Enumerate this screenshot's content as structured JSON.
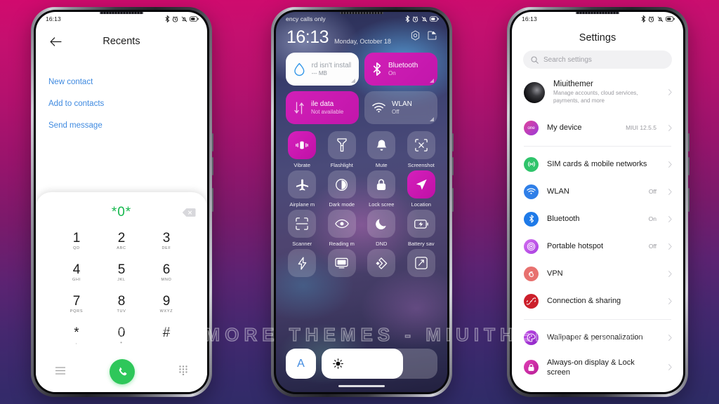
{
  "background": {
    "top_color": "#d10a6e",
    "bottom_color": "#2e2c66"
  },
  "watermark": {
    "text": "VISIT FOR MORE THEMES - MIUITHEMER.COM"
  },
  "phone1": {
    "status": {
      "time": "16:13",
      "icons": [
        "bluetooth-icon",
        "alarm-icon",
        "vibrate-icon",
        "battery-icon"
      ]
    },
    "header": {
      "back": "back-arrow-icon",
      "title": "Recents"
    },
    "links": [
      {
        "label": "New contact"
      },
      {
        "label": "Add to contacts"
      },
      {
        "label": "Send message"
      }
    ],
    "dialer": {
      "number": "*0*",
      "backspace": "backspace-icon",
      "keys": [
        {
          "digit": "1",
          "letters": "QD"
        },
        {
          "digit": "2",
          "letters": "ABC"
        },
        {
          "digit": "3",
          "letters": "DEF"
        },
        {
          "digit": "4",
          "letters": "GHI"
        },
        {
          "digit": "5",
          "letters": "JKL"
        },
        {
          "digit": "6",
          "letters": "MNO"
        },
        {
          "digit": "7",
          "letters": "PQRS"
        },
        {
          "digit": "8",
          "letters": "TUV"
        },
        {
          "digit": "9",
          "letters": "WXYZ"
        },
        {
          "digit": "*",
          "letters": ","
        },
        {
          "digit": "0",
          "letters": "+"
        },
        {
          "digit": "#",
          "letters": ""
        }
      ],
      "bottom": {
        "left_icon": "menu-icon",
        "call_icon": "phone-call-icon",
        "right_icon": "keypad-icon"
      },
      "call_button_color": "#2ec75a",
      "number_color": "#16b84e"
    }
  },
  "phone2": {
    "status": {
      "carrier": "ency calls only",
      "icons": [
        "bluetooth-icon",
        "alarm-icon",
        "vibrate-icon",
        "battery-icon"
      ]
    },
    "clock": {
      "time": "16:13",
      "date": "Monday, October 18"
    },
    "clock_actions": [
      {
        "name": "settings-gear-icon"
      },
      {
        "name": "edit-icon"
      }
    ],
    "big_tiles": [
      {
        "name": "sim-data-tile",
        "icon": "water-drop-icon",
        "title": "rd isn't install",
        "subtitle": "--- MB",
        "state": "white"
      },
      {
        "name": "bluetooth-tile",
        "icon": "bluetooth-icon",
        "title": "Bluetooth",
        "subtitle": "On",
        "state": "magenta"
      },
      {
        "name": "mobile-data-tile",
        "icon": "data-arrows-icon",
        "title": "ile data",
        "subtitle": "Not available",
        "state": "magenta"
      },
      {
        "name": "wlan-tile",
        "icon": "wifi-icon",
        "title": "WLAN",
        "subtitle": "Off",
        "state": "glass"
      }
    ],
    "toggles": [
      {
        "label": "Vibrate",
        "icon": "vibrate-icon",
        "on": true
      },
      {
        "label": "Flashlight",
        "icon": "flashlight-icon",
        "on": false
      },
      {
        "label": "Mute",
        "icon": "bell-icon",
        "on": false
      },
      {
        "label": "Screenshot",
        "icon": "screenshot-icon",
        "on": false
      },
      {
        "label": "Airplane m",
        "icon": "airplane-icon",
        "on": false
      },
      {
        "label": "Dark mode",
        "icon": "contrast-icon",
        "on": false
      },
      {
        "label": "Lock scree",
        "icon": "lock-icon",
        "on": false
      },
      {
        "label": "Location",
        "icon": "location-arrow-icon",
        "on": true
      },
      {
        "label": "Scanner",
        "icon": "scan-frame-icon",
        "on": false
      },
      {
        "label": "Reading m",
        "icon": "eye-icon",
        "on": false
      },
      {
        "label": "DND",
        "icon": "moon-icon",
        "on": false
      },
      {
        "label": "Battery sav",
        "icon": "battery-saver-icon",
        "on": false
      },
      {
        "label": "",
        "icon": "lightning-icon",
        "on": false
      },
      {
        "label": "",
        "icon": "cast-screen-icon",
        "on": false
      },
      {
        "label": "",
        "icon": "diamond-icon",
        "on": false
      },
      {
        "label": "",
        "icon": "expand-icon",
        "on": false
      }
    ],
    "brightness": {
      "auto_label": "A",
      "icon": "sun-icon",
      "percent": 70
    },
    "accent_color": "#d11fb7"
  },
  "phone3": {
    "status": {
      "time": "16:13",
      "icons": [
        "bluetooth-icon",
        "alarm-icon",
        "vibrate-icon",
        "battery-icon"
      ]
    },
    "title": "Settings",
    "search": {
      "placeholder": "Search settings",
      "value": "",
      "icon": "search-icon"
    },
    "account": {
      "name": "Miuithemer",
      "subtitle": "Manage accounts, cloud services, payments, and more"
    },
    "device": {
      "label": "My device",
      "value": "MIUI 12.5.5",
      "badge": "one"
    },
    "rows": [
      {
        "label": "SIM cards & mobile networks",
        "value": "",
        "icon": "sim-network-icon",
        "color": "#2fc46b"
      },
      {
        "label": "WLAN",
        "value": "Off",
        "icon": "wifi-icon",
        "color": "#2f7fe8"
      },
      {
        "label": "Bluetooth",
        "value": "On",
        "icon": "bluetooth-icon",
        "color": "#1f7ae8"
      },
      {
        "label": "Portable hotspot",
        "value": "Off",
        "icon": "hotspot-icon",
        "color": "#c44ce0"
      },
      {
        "label": "VPN",
        "value": "",
        "icon": "vpn-icon",
        "color": "#e8716f"
      },
      {
        "label": "Connection & sharing",
        "value": "",
        "icon": "link-icon",
        "color": "#cc1f2b"
      }
    ],
    "rows2": [
      {
        "label": "Wallpaper & personalization",
        "value": "",
        "icon": "palette-icon",
        "color": "#a32fd0"
      },
      {
        "label": "Always-on display & Lock screen",
        "value": "",
        "icon": "lock-icon",
        "color": "#c72ba8"
      }
    ]
  }
}
